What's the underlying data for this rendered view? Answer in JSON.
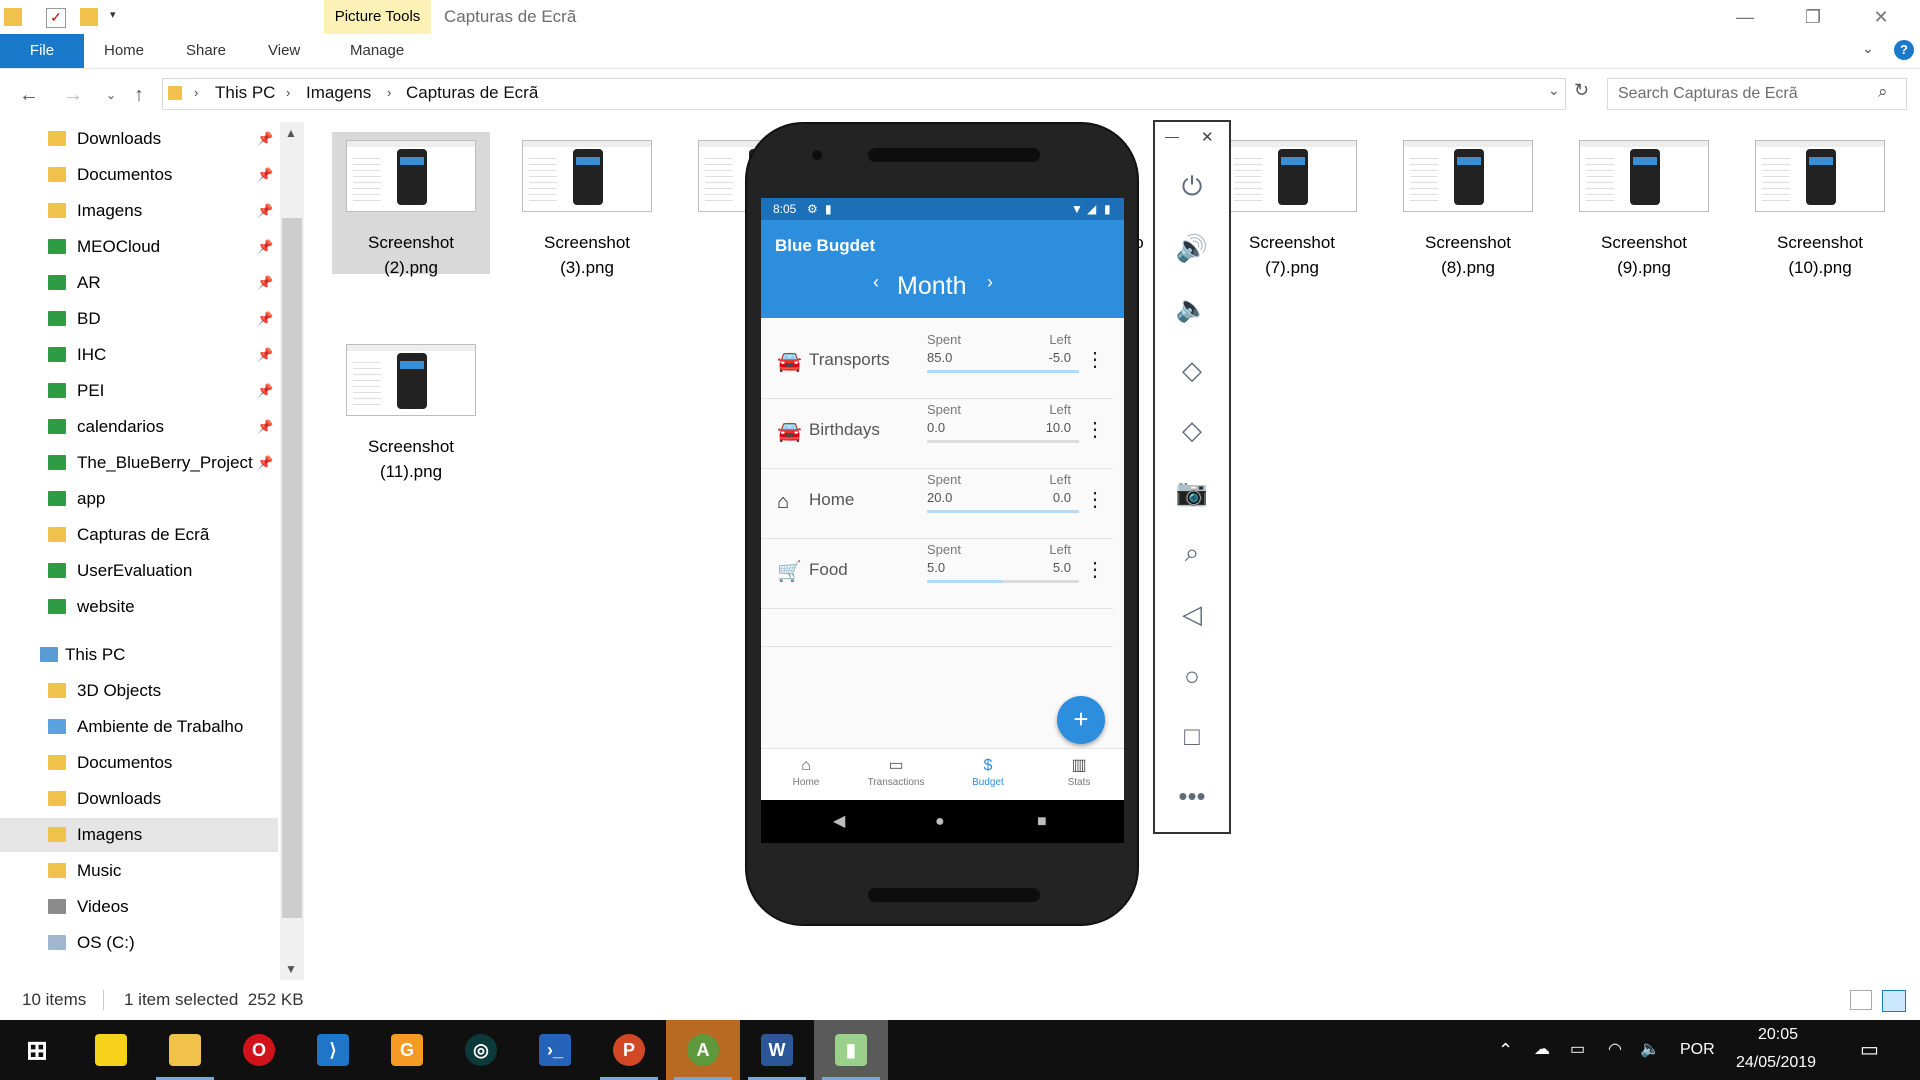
{
  "window": {
    "picture_tools": "Picture Tools",
    "title": "Capturas de Ecrã",
    "controls": {
      "minimize": "—",
      "maximize": "❐",
      "close": "✕"
    }
  },
  "ribbon": {
    "file": "File",
    "tabs": [
      "Home",
      "Share",
      "View",
      "Manage"
    ]
  },
  "address": {
    "crumbs": [
      "This PC",
      "Imagens",
      "Capturas de Ecrã"
    ],
    "search_placeholder": "Search Capturas de Ecrã"
  },
  "sidebar": {
    "quick_access": [
      {
        "label": "Downloads",
        "pinned": true
      },
      {
        "label": "Documentos",
        "pinned": true
      },
      {
        "label": "Imagens",
        "pinned": true
      },
      {
        "label": "MEOCloud",
        "pinned": true
      },
      {
        "label": "AR",
        "pinned": true
      },
      {
        "label": "BD",
        "pinned": true
      },
      {
        "label": "IHC",
        "pinned": true
      },
      {
        "label": "PEI",
        "pinned": true
      },
      {
        "label": "calendarios",
        "pinned": true
      },
      {
        "label": "The_BlueBerry_Project",
        "pinned": true
      },
      {
        "label": "app",
        "pinned": false
      },
      {
        "label": "Capturas de Ecrã",
        "pinned": false
      },
      {
        "label": "UserEvaluation",
        "pinned": false
      },
      {
        "label": "website",
        "pinned": false
      }
    ],
    "this_pc": "This PC",
    "this_pc_items": [
      "3D Objects",
      "Ambiente de Trabalho",
      "Documentos",
      "Downloads",
      "Imagens",
      "Music",
      "Videos",
      "OS (C:)"
    ],
    "selected": "Imagens"
  },
  "files": [
    {
      "line1": "Screenshot",
      "line2": "(2).png",
      "selected": true
    },
    {
      "line1": "Screenshot",
      "line2": "(3).png",
      "selected": false
    },
    {
      "line1": "Scr",
      "line2": "(4",
      "selected": false
    },
    {
      "line1": "",
      "line2": "o",
      "selected": false
    },
    {
      "line1": "Screenshot",
      "line2": "(7).png",
      "selected": false
    },
    {
      "line1": "Screenshot",
      "line2": "(8).png",
      "selected": false
    },
    {
      "line1": "Screenshot",
      "line2": "(9).png",
      "selected": false
    },
    {
      "line1": "Screenshot",
      "line2": "(10).png",
      "selected": false
    },
    {
      "line1": "Screenshot",
      "line2": "(11).png",
      "selected": false
    }
  ],
  "status": {
    "count": "10 items",
    "selection": "1 item selected  252 KB"
  },
  "phone": {
    "time": "8:05",
    "app_title": "Blue Bugdet",
    "period": "Month",
    "spent_label": "Spent",
    "left_label": "Left",
    "categories": [
      {
        "name": "Transports",
        "icon": "car-icon",
        "spent": "85.0",
        "left": "-5.0",
        "progress": 1.0
      },
      {
        "name": "Birthdays",
        "icon": "car-icon",
        "spent": "0.0",
        "left": "10.0",
        "progress": 0.0
      },
      {
        "name": "Home",
        "icon": "home-icon",
        "spent": "20.0",
        "left": "0.0",
        "progress": 1.0
      },
      {
        "name": "Food",
        "icon": "cart-icon",
        "spent": "5.0",
        "left": "5.0",
        "progress": 0.5
      }
    ],
    "fab": "+",
    "nav": [
      {
        "label": "Home",
        "active": false
      },
      {
        "label": "Transactions",
        "active": false
      },
      {
        "label": "Budget",
        "active": true
      },
      {
        "label": "Stats",
        "active": false
      }
    ],
    "accent": "#2e8ede"
  },
  "emulator": {
    "minimize": "—",
    "close": "✕",
    "buttons": [
      "power-icon",
      "volume-up-icon",
      "volume-down-icon",
      "rotate-left-icon",
      "rotate-right-icon",
      "camera-icon",
      "zoom-icon",
      "back-icon",
      "home-icon",
      "overview-icon",
      "more-icon"
    ]
  },
  "tray": {
    "lang": "POR",
    "time": "20:05",
    "date": "24/05/2019"
  }
}
